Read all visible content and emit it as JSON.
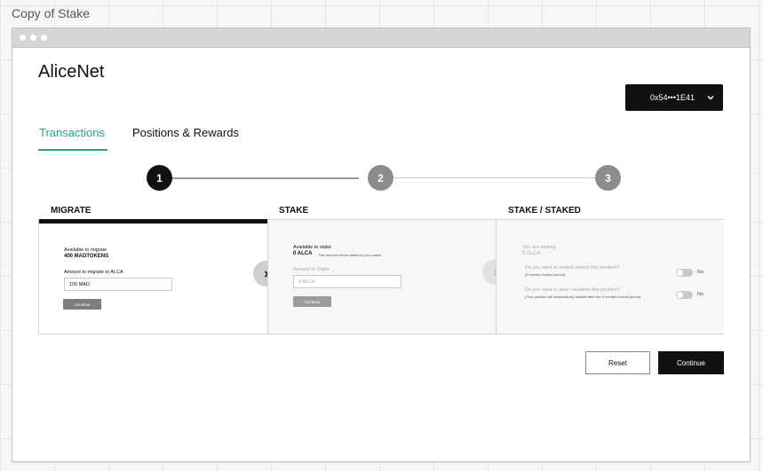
{
  "canvas": {
    "title": "Copy of Stake"
  },
  "app": {
    "title": "AliceNet"
  },
  "wallet": {
    "address": "0x54•••1E41"
  },
  "tabs": [
    {
      "label": "Transactions",
      "active": true
    },
    {
      "label": "Positions & Rewards",
      "active": false
    }
  ],
  "steps": [
    {
      "number": "1",
      "state": "active"
    },
    {
      "number": "2",
      "state": "inactive"
    },
    {
      "number": "3",
      "state": "inactive"
    }
  ],
  "columns": {
    "migrate": {
      "heading": "MIGRATE",
      "available_label": "Available to migrate",
      "available_value": "400 MADTOKENS",
      "amount_label": "Amount to migrate to ALCA",
      "amount_value": "100 MAD",
      "continue_label": "Continue"
    },
    "stake": {
      "heading": "STAKE",
      "available_label": "Available to stake",
      "available_value": "0 ALCA",
      "available_note": "This amount will be added to your wallet",
      "amount_label": "Amount to Stake",
      "amount_placeholder": "0 ALCA",
      "continue_label": "Continue"
    },
    "staked": {
      "heading": "STAKE / STAKED",
      "staking_label": "You are staking",
      "staking_value": "0 ALCA",
      "q1": "Do you want to staked staked this position?",
      "q1_note": "(6 months lockout period)",
      "q1_value": "No",
      "q2": "Do you want to auto- restaked this position?",
      "q2_note": "(Your position will automatically restake after the 6 months lockout period)",
      "q2_value": "No"
    }
  },
  "footer": {
    "reset_label": "Reset",
    "continue_label": "Continue"
  },
  "colors": {
    "accent": "#1ea58d",
    "dark": "#111111",
    "step_inactive": "#8c8c8c",
    "button_disabled": "#9b9b9b",
    "button_mini_active": "#7d7d7d"
  }
}
